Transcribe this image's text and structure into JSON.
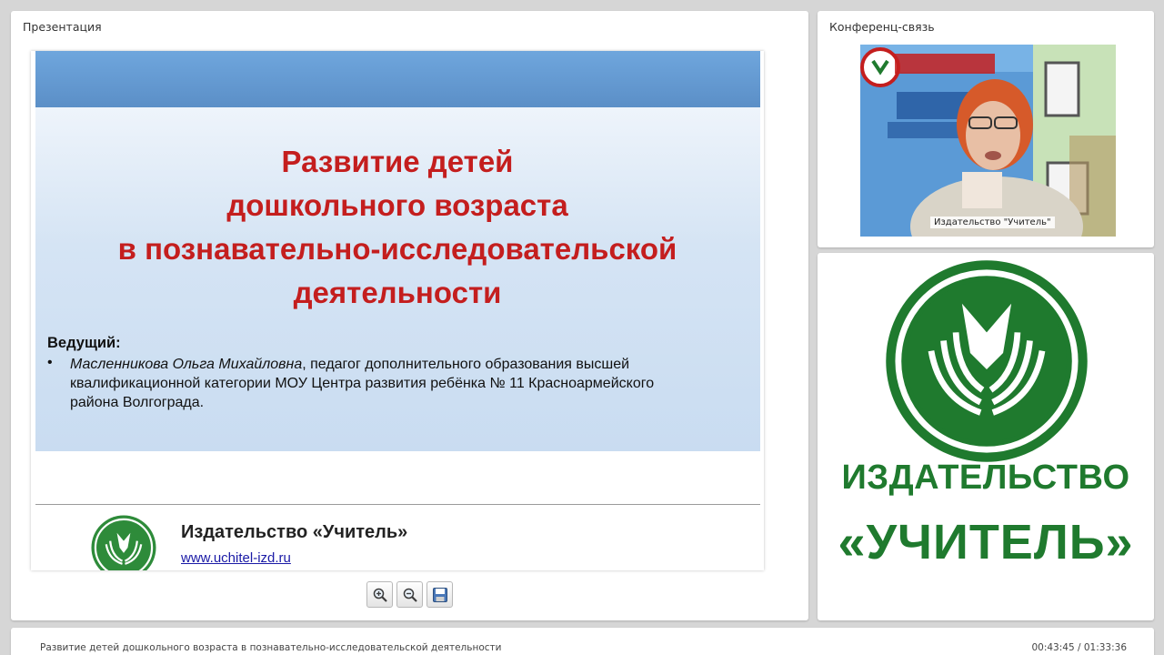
{
  "presentation_panel": {
    "title": "Презентация",
    "slide": {
      "title_lines": [
        "Развитие детей",
        "дошкольного возраста",
        "в познавательно-исследовательской",
        "деятельности"
      ],
      "host_label": "Ведущий:",
      "host_bullet": "•",
      "host_name": "Масленникова Ольга Михайловна",
      "host_description_line1": ", педагог дополнительного образования высшей",
      "host_description_line2": "квалификационной категории МОУ Центра развития ребёнка № 11 Красноармейского",
      "host_description_line3": "района Волгограда.",
      "publisher_name": "Издательство «Учитель»",
      "publisher_url": "www.uchitel-izd.ru"
    },
    "toolbar": {
      "zoom_in_icon": "zoom-in-icon",
      "zoom_out_icon": "zoom-out-icon",
      "save_icon": "floppy-disk-icon"
    }
  },
  "conference_panel": {
    "title": "Конференц-связь",
    "video_label": "Издательство \"Учитель\""
  },
  "logo_panel": {
    "brand_line1": "ИЗДАТЕЛЬСТВО",
    "brand_line2": "«УЧИТЕЛЬ»"
  },
  "status_bar": {
    "session_title": "Развитие детей дошкольного возраста в познавательно-исследовательской деятельности",
    "time": "00:43:45 / 01:33:36"
  },
  "colors": {
    "brand_green": "#1f7a2e",
    "slide_title_red": "#c41e1e",
    "slide_band_blue": "#6fa6dd",
    "link_blue": "#1a1aa6"
  }
}
